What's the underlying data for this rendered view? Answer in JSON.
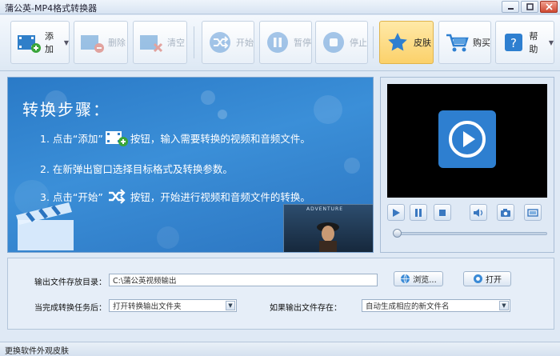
{
  "window": {
    "title": "蒲公英-MP4格式转换器"
  },
  "toolbar": {
    "add": "添加",
    "delete": "删除",
    "clear": "清空",
    "start": "开始",
    "pause": "暂停",
    "stop": "停止",
    "skin": "皮肤",
    "buy": "购买",
    "help": "帮助"
  },
  "guide": {
    "heading": "转换步骤：",
    "step1_pre": "1. 点击“添加”",
    "step1_post": "按钮，输入需要转换的视频和音频文件。",
    "step2": "2. 在新弹出窗口选择目标格式及转换参数。",
    "step3_pre": "3. 点击“开始”",
    "step3_post": "按钮，开始进行视频和音频文件的转换。",
    "poster_text": "ADVENTURE"
  },
  "settings": {
    "output_dir_label": "输出文件存放目录：",
    "output_dir_value": "C:\\蒲公英视频输出",
    "browse": "浏览...",
    "open": "打开",
    "after_done_label": "当完成转换任务后：",
    "after_done_value": "打开转换输出文件夹",
    "if_exists_label": "如果输出文件存在：",
    "if_exists_value": "自动生成相应的新文件名"
  },
  "player": {
    "progress_fraction": 0
  },
  "statusbar": {
    "text": "更换软件外观皮肤"
  },
  "colors": {
    "accent": "#2e7fd0",
    "skin_bg": "#fbd16a",
    "panel_blue": "#3b8fd8"
  }
}
